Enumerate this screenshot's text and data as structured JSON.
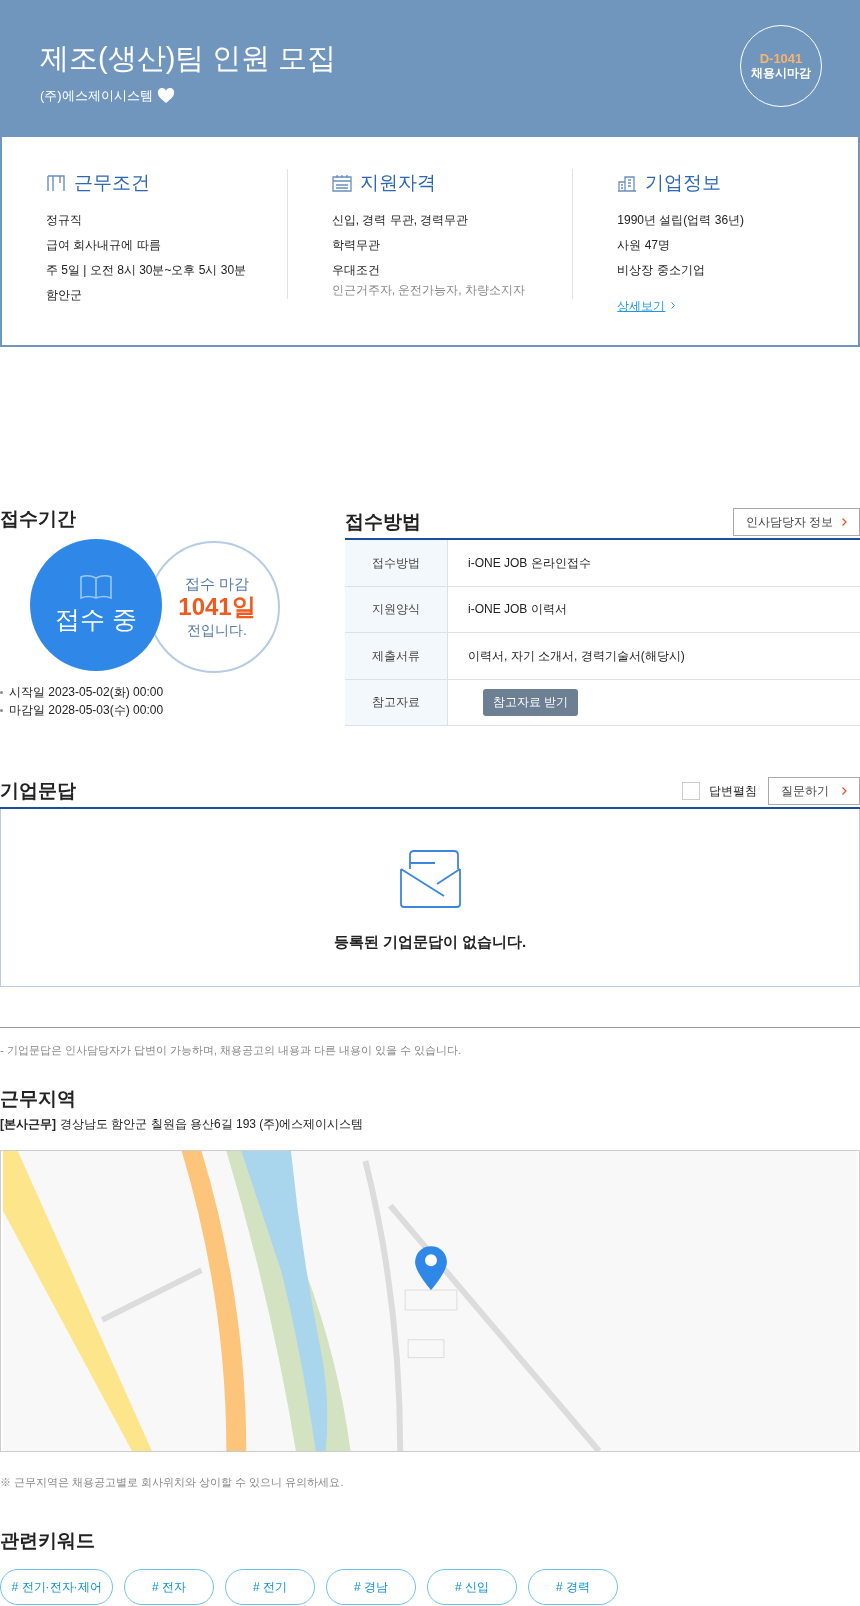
{
  "header": {
    "title": "제조(생산)팀 인원 모집",
    "company": "(주)에스제이시스템",
    "badge": {
      "dday": "D-1041",
      "label": "채용시마감"
    }
  },
  "summary": [
    {
      "kind": "conditions",
      "title": "근무조건",
      "lines": [
        "정규직",
        "급여 회사내규에 따름",
        "주 5일 | 오전 8시 30분~오후 5시 30분",
        "함안군"
      ]
    },
    {
      "kind": "qualifications",
      "title": "지원자격",
      "lines": [
        "신입, 경력 무관, 경력무관",
        "학력무관",
        "우대조건"
      ],
      "note": "인근거주자, 운전가능자, 차량소지자"
    },
    {
      "kind": "company",
      "title": "기업정보",
      "lines": [
        "1990년 설립(업력 36년)",
        "사원 47명",
        "비상장 중소기업"
      ],
      "link": "상세보기"
    }
  ],
  "period": {
    "title": "접수기간",
    "status": "접수 중",
    "deadline_top": "접수 마감",
    "deadline_days": "1041일",
    "deadline_bottom": "전입니다.",
    "dates": [
      "시작일 2023-05-02(화) 00:00",
      "마감일 2028-05-03(수) 00:00"
    ]
  },
  "method": {
    "title": "접수방법",
    "contact_button": "인사담당자 정보",
    "rows": [
      {
        "label": "접수방법",
        "value": "i-ONE JOB 온라인접수"
      },
      {
        "label": "지원양식",
        "value": "i-ONE JOB 이력서"
      },
      {
        "label": "제출서류",
        "value": "이력서, 자기 소개서, 경력기술서(해당시)"
      },
      {
        "label": "참고자료",
        "button": "참고자료 받기"
      }
    ]
  },
  "qna": {
    "title": "기업문답",
    "expand_label": "답변펼침",
    "expand_checked": false,
    "ask_button": "질문하기",
    "empty_message": "등록된 기업문답이 없습니다.",
    "note": "- 기업문답은 인사담당자가 답변이 가능하며, 채용공고의 내용과 다른 내용이 있을 수 있습니다."
  },
  "location": {
    "title": "근무지역",
    "address_tag": "[본사근무]",
    "address": "경상남도 함안군 칠원읍 용산6길 193 (주)에스제이시스템",
    "note": "※ 근무지역은 채용공고별로 회사위치와 상이할 수 있으니 유의하세요."
  },
  "keywords": {
    "title": "관련키워드",
    "items": [
      "# 전기·전자·제어",
      "# 전자",
      "# 전기",
      "# 경남",
      "# 신입",
      "# 경력"
    ]
  }
}
